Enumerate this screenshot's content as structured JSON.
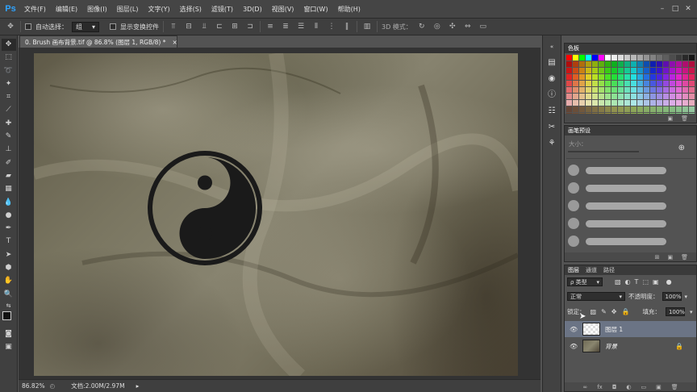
{
  "app": {
    "logo": "Ps"
  },
  "menu": [
    "文件(F)",
    "编辑(E)",
    "图像(I)",
    "图层(L)",
    "文字(Y)",
    "选择(S)",
    "滤镜(T)",
    "3D(D)",
    "视图(V)",
    "窗口(W)",
    "帮助(H)"
  ],
  "options": {
    "auto_select_label": "自动选择：",
    "auto_select_value": "组",
    "show_transform_label": "显示变换控件",
    "mode3d_label": "3D 模式："
  },
  "document": {
    "tab_title": "0. Brush 画布背景.tif @ 86.8% (图层 1, RGB/8) *",
    "tab_close": "×"
  },
  "status": {
    "zoom": "86.82%",
    "doc_info": "文档:2.00M/2.97M"
  },
  "panels": {
    "swatches": {
      "title": "色板"
    },
    "brush_presets": {
      "title": "画笔预设",
      "size_label": "大小："
    },
    "layers": {
      "tabs": [
        "图层",
        "通道",
        "路径"
      ],
      "filter_kind": "ρ 类型",
      "blend_mode": "正常",
      "opacity_label": "不透明度：",
      "opacity_value": "100%",
      "lock_label": "锁定：",
      "fill_label": "填充：",
      "fill_value": "100%",
      "items": [
        {
          "name": "图层 1",
          "selected": true
        },
        {
          "name": "背景",
          "selected": false
        }
      ]
    }
  },
  "colors": {
    "accent": "#2fa3ff",
    "selection": "#6b7485"
  }
}
